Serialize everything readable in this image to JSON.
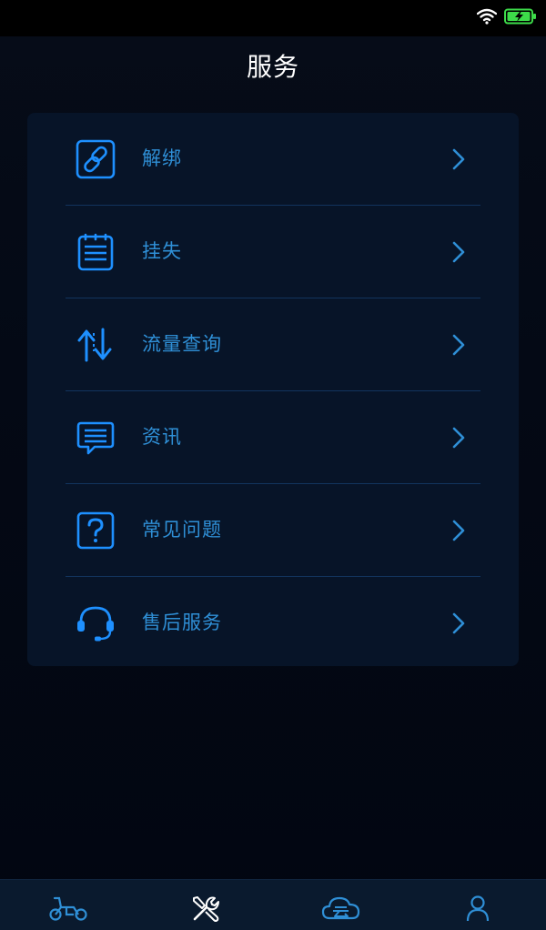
{
  "header": {
    "title": "服务"
  },
  "menu": {
    "items": [
      {
        "label": "解绑",
        "icon": "unlink-icon"
      },
      {
        "label": "挂失",
        "icon": "report-loss-icon"
      },
      {
        "label": "流量查询",
        "icon": "data-traffic-icon"
      },
      {
        "label": "资讯",
        "icon": "news-icon"
      },
      {
        "label": "常见问题",
        "icon": "faq-icon"
      },
      {
        "label": "售后服务",
        "icon": "headset-icon"
      }
    ]
  },
  "tab_bar": {
    "tabs": [
      {
        "icon": "scooter-icon",
        "active": false
      },
      {
        "icon": "tools-icon",
        "active": true
      },
      {
        "icon": "cloud-icon",
        "active": false
      },
      {
        "icon": "user-icon",
        "active": false
      }
    ]
  },
  "colors": {
    "accent": "#2f8fd6",
    "icon_blue": "#1e90ff",
    "background": "#040915",
    "card": "#071428",
    "divider": "#12345e",
    "title": "#ffffff",
    "tab_active": "#ffffff"
  }
}
